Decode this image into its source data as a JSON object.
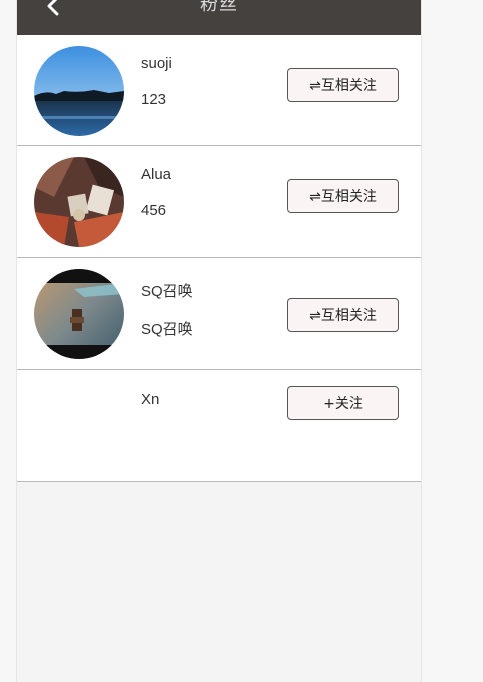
{
  "header": {
    "title": "粉丝",
    "back_icon": "chevron-left-icon"
  },
  "fans": [
    {
      "name": "suoji",
      "sub": "123",
      "button": "⇌互相关注",
      "avatar": "lake-photo"
    },
    {
      "name": "Alua",
      "sub": "456",
      "button": "⇌互相关注",
      "avatar": "cozy-blanket-photo"
    },
    {
      "name": "SQ召唤",
      "sub": "SQ召唤",
      "button": "⇌互相关注",
      "avatar": "sea-sunset-photo"
    },
    {
      "name": "Xn",
      "sub": "",
      "button": "+关注",
      "avatar": ""
    }
  ],
  "colors": {
    "header_bg": "#44413f",
    "button_bg": "#fbf4f4",
    "divider": "#b9b9b9"
  }
}
